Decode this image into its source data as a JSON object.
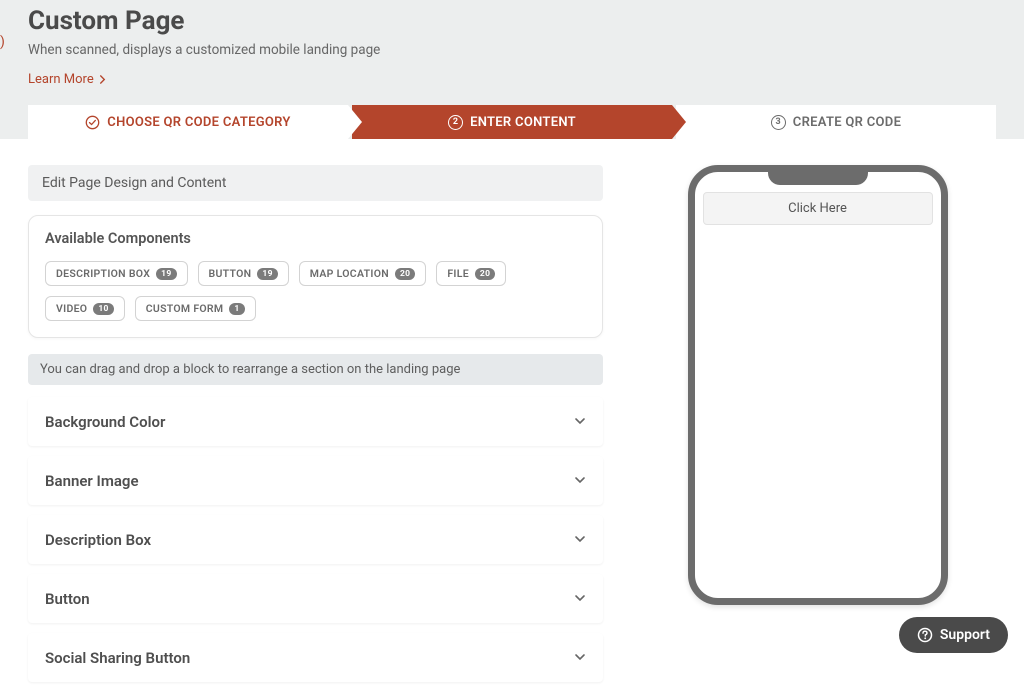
{
  "header": {
    "title": "Custom Page",
    "subtitle": "When scanned, displays a customized mobile landing page",
    "learn_more": "Learn More"
  },
  "steps": {
    "s1_label": "CHOOSE QR CODE CATEGORY",
    "s2_num": "2",
    "s2_label": "ENTER CONTENT",
    "s3_num": "3",
    "s3_label": "CREATE QR CODE"
  },
  "editor": {
    "section_header": "Edit Page Design and Content",
    "components_title": "Available Components",
    "hint": "You can drag and drop a block to rearrange a section on the landing page"
  },
  "components": [
    {
      "label": "DESCRIPTION BOX",
      "count": "19"
    },
    {
      "label": "BUTTON",
      "count": "19"
    },
    {
      "label": "MAP LOCATION",
      "count": "20"
    },
    {
      "label": "FILE",
      "count": "20"
    },
    {
      "label": "VIDEO",
      "count": "10"
    },
    {
      "label": "CUSTOM FORM",
      "count": "1"
    }
  ],
  "accordion": [
    {
      "label": "Background Color"
    },
    {
      "label": "Banner Image"
    },
    {
      "label": "Description Box"
    },
    {
      "label": "Button"
    },
    {
      "label": "Social Sharing Button"
    }
  ],
  "preview": {
    "button_label": "Click Here"
  },
  "support": {
    "label": "Support"
  }
}
